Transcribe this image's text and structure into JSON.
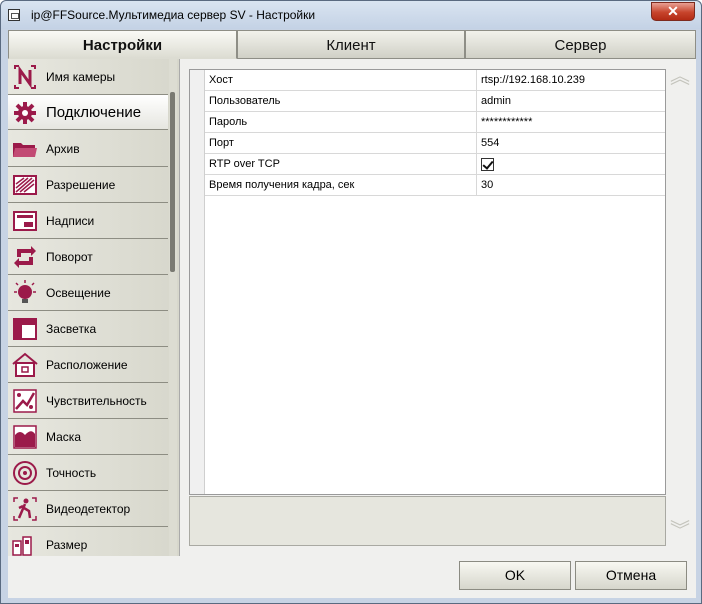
{
  "window": {
    "title": "ip@FFSource.Мультимедиа сервер SV - Настройки",
    "close_glyph": "✕"
  },
  "tabs": [
    {
      "label": "Настройки",
      "active": true
    },
    {
      "label": "Клиент",
      "active": false
    },
    {
      "label": "Сервер",
      "active": false
    }
  ],
  "sidebar": {
    "items": [
      {
        "label": "Имя камеры",
        "icon": "camera-name-icon"
      },
      {
        "label": "Подключение",
        "icon": "gear-icon",
        "active": true
      },
      {
        "label": "Архив",
        "icon": "folder-icon"
      },
      {
        "label": "Разрешение",
        "icon": "resolution-icon"
      },
      {
        "label": "Надписи",
        "icon": "captions-icon"
      },
      {
        "label": "Поворот",
        "icon": "rotate-icon"
      },
      {
        "label": "Освещение",
        "icon": "lighting-icon"
      },
      {
        "label": "Засветка",
        "icon": "backlight-icon"
      },
      {
        "label": "Расположение",
        "icon": "house-icon"
      },
      {
        "label": "Чувствительность",
        "icon": "sensitivity-icon"
      },
      {
        "label": "Маска",
        "icon": "mask-icon"
      },
      {
        "label": "Точность",
        "icon": "target-icon"
      },
      {
        "label": "Видеодетектор",
        "icon": "motion-detector-icon"
      },
      {
        "label": "Размер",
        "icon": "size-icon"
      }
    ]
  },
  "properties": [
    {
      "key": "Хост",
      "value": "rtsp://192.168.10.239"
    },
    {
      "key": "Пользователь",
      "value": "admin"
    },
    {
      "key": "Пароль",
      "value": "************"
    },
    {
      "key": "Порт",
      "value": "554"
    },
    {
      "key": "RTP over TCP",
      "value": "",
      "checked": true
    },
    {
      "key": "Время получения кадра, сек",
      "value": "30"
    }
  ],
  "buttons": {
    "ok": "OK",
    "cancel": "Отмена"
  },
  "colors": {
    "accent": "#9b1a4a",
    "titlebar": "#c4d2e5"
  }
}
